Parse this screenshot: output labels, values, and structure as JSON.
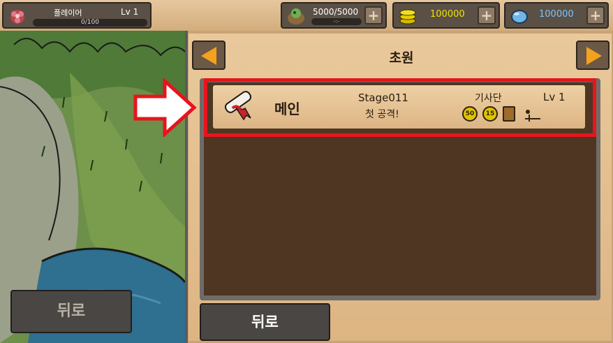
{
  "player": {
    "name": "플레이어",
    "level": "Lv 1",
    "exp": "0/100"
  },
  "resources": {
    "stamina": {
      "value": "5000/5000",
      "sub": "-:-",
      "icon": "stamina-bag-icon"
    },
    "gold": {
      "value": "100000",
      "color": "#f2e200",
      "icon": "gold-coin-icon"
    },
    "gem": {
      "value": "100000",
      "color": "#7fc4ff",
      "icon": "gem-icon"
    },
    "plus_label": "+"
  },
  "region": {
    "title": "초원"
  },
  "stages": [
    {
      "type": "메인",
      "name": "Stage011",
      "subtitle": "첫 공격!",
      "guild": "기사단",
      "level": "Lv 1",
      "rewards": [
        "50",
        "15"
      ]
    }
  ],
  "buttons": {
    "back_left": "뒤로",
    "back_right": "뒤로"
  },
  "colors": {
    "highlight": "#e8141c",
    "arrow": "#f2a21c"
  }
}
